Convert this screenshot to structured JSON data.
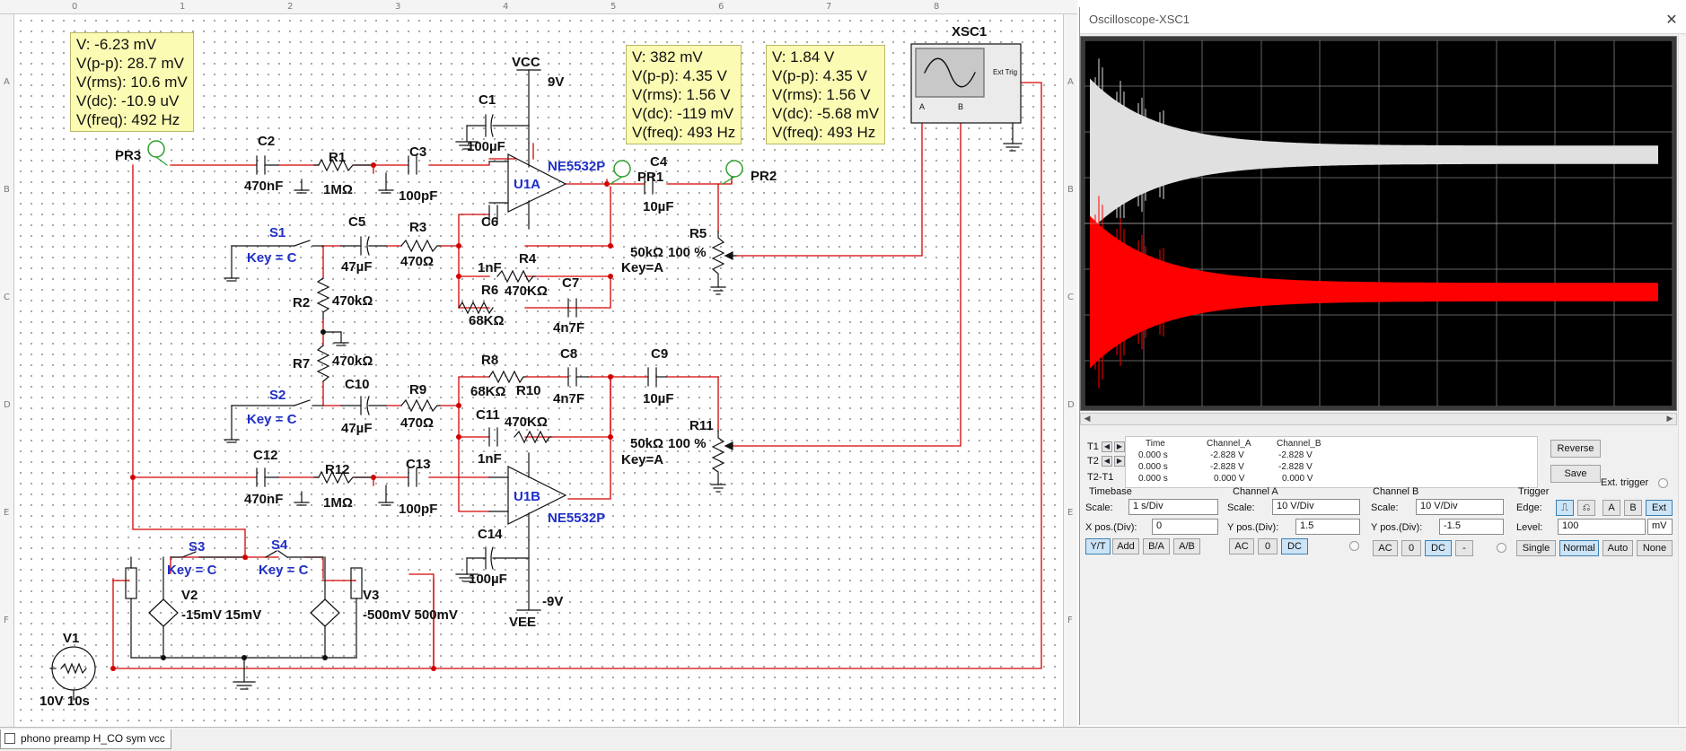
{
  "rulers": {
    "top": [
      "0",
      "1",
      "2",
      "3",
      "4",
      "5",
      "6",
      "7",
      "8"
    ],
    "left": [
      "A",
      "B",
      "C",
      "D",
      "E",
      "F"
    ],
    "right": [
      "A",
      "B",
      "C",
      "D",
      "E",
      "F"
    ]
  },
  "probes": [
    {
      "name": "PR3",
      "lines": [
        "V: -6.23 mV",
        "V(p-p): 28.7 mV",
        "V(rms): 10.6 mV",
        "V(dc): -10.9 uV",
        "V(freq): 492 Hz"
      ]
    },
    {
      "name": "PR1",
      "lines": [
        "V: 382 mV",
        "V(p-p): 4.35 V",
        "V(rms): 1.56 V",
        "V(dc): -119 mV",
        "V(freq): 493 Hz"
      ]
    },
    {
      "name": "PR2",
      "lines": [
        "V: 1.84 V",
        "V(p-p): 4.35 V",
        "V(rms): 1.56 V",
        "V(dc): -5.68 mV",
        "V(freq): 493 Hz"
      ]
    }
  ],
  "labels": {
    "vcc": "VCC",
    "vcc_val": "9V",
    "vee": "VEE",
    "vee_val": "-9V",
    "c1": "C1",
    "c1_val": "100µF",
    "c2": "C2",
    "c2_val": "470nF",
    "r1": "R1",
    "r1_val": "1MΩ",
    "c3": "C3",
    "c3_val": "100pF",
    "u1a": "U1A",
    "ne1": "NE5532P",
    "c4": "C4",
    "c4_val": "10µF",
    "pr1": "PR1",
    "pr2": "PR2",
    "pr3": "PR3",
    "s1": "S1",
    "s1_key": "Key = C",
    "c5": "C5",
    "c5_val": "47µF",
    "r3": "R3",
    "r3_val": "470Ω",
    "c6": "C6",
    "c6_val": "1nF",
    "r4": "R4",
    "r4_val": "470KΩ",
    "r6": "R6",
    "r6_val": "68KΩ",
    "c7": "C7",
    "c7_val": "4n7F",
    "r5": "R5",
    "r5_val": "50kΩ",
    "r5_pct": "100 %",
    "r5_key": "Key=A",
    "r2": "R2",
    "r2_val": "470kΩ",
    "r7": "R7",
    "r7_val": "470kΩ",
    "r8": "R8",
    "r8_val": "68KΩ",
    "c8": "C8",
    "c8_val": "4n7F",
    "c9": "C9",
    "c9_val": "10µF",
    "s2": "S2",
    "s2_key": "Key = C",
    "c10": "C10",
    "c10_val": "47µF",
    "r9": "R9",
    "r9_val": "470Ω",
    "r10": "R10",
    "c11": "C11",
    "c11_val": "470KΩ",
    "c11b_val": "1nF",
    "r11": "R11",
    "r11_val": "50kΩ",
    "r11_pct": "100 %",
    "r11_key": "Key=A",
    "c12": "C12",
    "c12_val": "470nF",
    "r12": "R12",
    "r12_val": "1MΩ",
    "c13": "C13",
    "c13_val": "100pF",
    "u1b": "U1B",
    "ne2": "NE5532P",
    "c14": "C14",
    "c14_val": "100µF",
    "s3": "S3",
    "s3_key": "Key = C",
    "s4": "S4",
    "s4_key": "Key = C",
    "v2": "V2",
    "v2_val": "-15mV 15mV",
    "v3": "V3",
    "v3_val": "-500mV 500mV",
    "v1": "V1",
    "v1_val": "10V 10s",
    "xsc1": "XSC1",
    "ext_trig": "Ext Trig",
    "pin_a": "A",
    "pin_b": "B"
  },
  "oscilloscope": {
    "title": "Oscilloscope-XSC1",
    "close": "✕",
    "cursor_table": {
      "headers": [
        "Time",
        "Channel_A",
        "Channel_B"
      ],
      "rows": [
        {
          "label": "T1",
          "time": "0.000 s",
          "a": "-2.828 V",
          "b": "-2.828 V"
        },
        {
          "label": "T2",
          "time": "0.000 s",
          "a": "-2.828 V",
          "b": "-2.828 V"
        },
        {
          "label": "T2-T1",
          "time": "0.000 s",
          "a": "0.000 V",
          "b": "0.000 V"
        }
      ]
    },
    "reverse": "Reverse",
    "save": "Save",
    "ext_trigger": "Ext. trigger",
    "timebase": {
      "title": "Timebase",
      "scale_label": "Scale:",
      "scale": "1 s/Div",
      "xpos_label": "X pos.(Div):",
      "xpos": "0",
      "modes": [
        "Y/T",
        "Add",
        "B/A",
        "A/B"
      ]
    },
    "channel_a": {
      "title": "Channel A",
      "scale_label": "Scale:",
      "scale": "10 V/Div",
      "ypos_label": "Y pos.(Div):",
      "ypos": "1.5",
      "coupling": [
        "AC",
        "0",
        "DC"
      ]
    },
    "channel_b": {
      "title": "Channel B",
      "scale_label": "Scale:",
      "scale": "10 V/Div",
      "ypos_label": "Y pos.(Div):",
      "ypos": "-1.5",
      "coupling": [
        "AC",
        "0",
        "DC",
        "-"
      ]
    },
    "trigger": {
      "title": "Trigger",
      "edge_label": "Edge:",
      "level_label": "Level:",
      "level": "100",
      "level_unit": "mV",
      "edge_buttons": [
        "A",
        "B",
        "Ext"
      ],
      "modes": [
        "Single",
        "Normal",
        "Auto",
        "None"
      ]
    },
    "colors": {
      "channel_a": "#e0e0e0",
      "channel_b": "#ff0000",
      "screen": "#000000",
      "grid": "#7f7f7f"
    }
  },
  "tab": {
    "label": "phono preamp H_CO sym vcc"
  },
  "colors": {
    "wire": "#d40000",
    "component": "#111111",
    "label_blue": "#1f2fc8",
    "probe_bg": "#fbfbb3"
  }
}
